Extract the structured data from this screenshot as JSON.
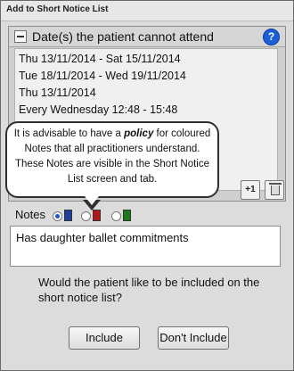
{
  "window": {
    "title": "Add to Short Notice List"
  },
  "dates_panel": {
    "title": "Date(s) the patient cannot attend",
    "help_glyph": "?",
    "items": [
      "Thu 13/11/2014 - Sat 15/11/2014",
      "Tue 18/11/2014 - Wed 19/11/2014",
      "Thu 13/11/2014",
      "Every Wednesday 12:48 - 15:48"
    ],
    "add_button_label": "+1"
  },
  "callout": {
    "text_before": "It is advisable to have a ",
    "text_emphasis": "policy",
    "text_after": " for coloured Notes that all practitioners understand. These Notes are visible in the Short Notice List screen and tab."
  },
  "notes": {
    "label": "Notes",
    "options": [
      {
        "color": "#1f3f9b",
        "selected": true
      },
      {
        "color": "#b01818",
        "selected": false
      },
      {
        "color": "#1a7a1a",
        "selected": false
      }
    ],
    "text": "Has daughter ballet commitments"
  },
  "question": "Would the patient like to be included on the short notice list?",
  "buttons": {
    "include": "Include",
    "dont_include": "Don't Include"
  }
}
